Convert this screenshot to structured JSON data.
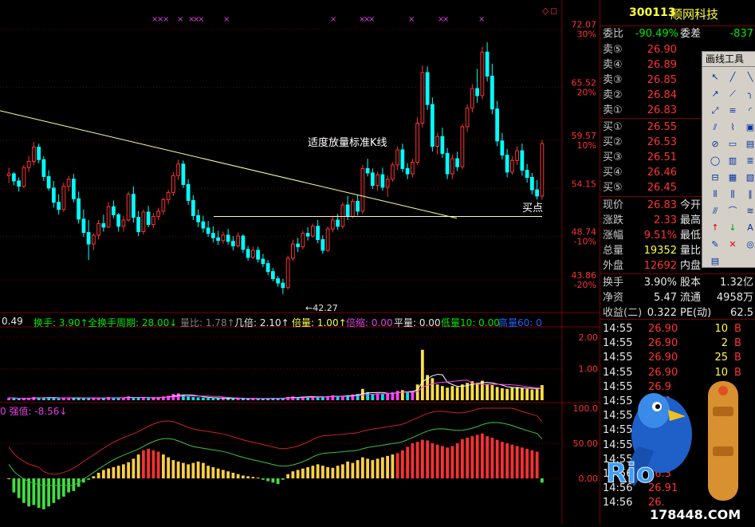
{
  "stock": {
    "code": "300113",
    "name": "顺网科技"
  },
  "price_axis": [
    {
      "price": "72.07",
      "pct": "30%"
    },
    {
      "price": "65.52",
      "pct": "20%"
    },
    {
      "price": "59.57",
      "pct": "10%"
    },
    {
      "price": "54.15",
      "pct": ""
    },
    {
      "price": "48.74",
      "pct": "-10%"
    },
    {
      "price": "43.86",
      "pct": "-20%"
    }
  ],
  "volume_axis": [
    "2.00",
    "1.00"
  ],
  "osc_axis": [
    "100.0",
    "50.00",
    "0.00"
  ],
  "annotations": {
    "breakout": "适度放量标准K线",
    "buy_point": "买点",
    "low_price": "←42.27"
  },
  "indicator_bar": [
    {
      "text": "0.49",
      "color": "#e8e8e8"
    },
    {
      "text": "换手: 3.90↑",
      "color": "#00e600"
    },
    {
      "text": "全换手周期: 28.00↓",
      "color": "#00e600"
    },
    {
      "text": "量比: 1.78↑",
      "color": "#808080"
    },
    {
      "text": "几倍: 2.10↑",
      "color": "#e8e8e8"
    },
    {
      "text": "倍量: 1.00↑",
      "color": "#ffff40"
    },
    {
      "text": "倍缩: 0.00",
      "color": "#e040e0"
    },
    {
      "text": "平量: 0.00",
      "color": "#e8e8e8"
    },
    {
      "text": "低量10: 0.00",
      "color": "#00e600"
    },
    {
      "text": "高量60: 0",
      "color": "#2060ff"
    }
  ],
  "osc_label": "0 强值: -8.56↓",
  "order_book": {
    "ratio_label": "委比",
    "ratio_value": "-90.49%",
    "diff_label": "委差",
    "diff_value": "-837",
    "asks": [
      {
        "label": "卖⑤",
        "price": "26.90"
      },
      {
        "label": "卖④",
        "price": "26.89"
      },
      {
        "label": "卖③",
        "price": "26.85"
      },
      {
        "label": "卖②",
        "price": "26.84"
      },
      {
        "label": "卖①",
        "price": "26.83"
      }
    ],
    "bids": [
      {
        "label": "买①",
        "price": "26.55"
      },
      {
        "label": "买②",
        "price": "26.53"
      },
      {
        "label": "买③",
        "price": "26.51"
      },
      {
        "label": "买④",
        "price": "26.46"
      },
      {
        "label": "买⑤",
        "price": "26.45"
      }
    ]
  },
  "quote_stats": [
    {
      "l1": "现价",
      "v1": "26.83",
      "c1": "red",
      "l2": "今开"
    },
    {
      "l1": "涨跌",
      "v1": "2.33",
      "c1": "red",
      "l2": "最高"
    },
    {
      "l1": "涨幅",
      "v1": "9.51%",
      "c1": "red",
      "l2": "最低"
    },
    {
      "l1": "总量",
      "v1": "19352",
      "c1": "yel",
      "l2": "量比"
    },
    {
      "l1": "外盘",
      "v1": "12692",
      "c1": "red",
      "l2": "内盘"
    }
  ],
  "fund_stats": [
    {
      "l1": "换手",
      "v1": "3.90%",
      "l2": "股本",
      "v2": "1.32亿"
    },
    {
      "l1": "净资",
      "v1": "5.47",
      "l2": "流通",
      "v2": "4958万"
    },
    {
      "l1": "收益(二)",
      "v1": "0.322",
      "l2": "PE(动)",
      "v2": "62.5"
    }
  ],
  "trades": [
    {
      "time": "14:55",
      "price": "26.90",
      "vol": "10",
      "side": "B"
    },
    {
      "time": "14:55",
      "price": "26.90",
      "vol": "2",
      "side": "B"
    },
    {
      "time": "14:55",
      "price": "26.90",
      "vol": "25",
      "side": "B"
    },
    {
      "time": "14:55",
      "price": "26.90",
      "vol": "10",
      "side": "B"
    },
    {
      "time": "14:55",
      "price": "26.9",
      "vol": "",
      "side": ""
    },
    {
      "time": "14:55",
      "price": "26.9",
      "vol": "",
      "side": ""
    },
    {
      "time": "14:55",
      "price": "",
      "vol": "",
      "side": ""
    },
    {
      "time": "14:55",
      "price": "",
      "vol": "",
      "side": ""
    },
    {
      "time": "14:55",
      "price": "",
      "vol": "",
      "side": ""
    },
    {
      "time": "14:55",
      "price": "",
      "vol": "",
      "side": ""
    },
    {
      "time": "14:56",
      "price": "26.3",
      "vol": "",
      "side": ""
    },
    {
      "time": "14:56",
      "price": "26.91",
      "vol": "",
      "side": ""
    },
    {
      "time": "14:56",
      "price": "26.",
      "vol": "",
      "side": ""
    }
  ],
  "drawing_tools": {
    "title": "画线工具"
  },
  "mascot": {
    "brand": "Rio"
  },
  "watermark": "178448.COM",
  "colors": {
    "up": "#ff3232",
    "down": "#00ffff",
    "grid": "#7a0000",
    "trend": "#ffffa0",
    "support": "#fff8c0",
    "ma_red": "#d02020",
    "ma_green": "#40c040"
  },
  "chart_data": {
    "type": "candlestick",
    "title": "",
    "ylim": [
      42.27,
      72.07
    ],
    "candles": [
      [
        55.6,
        56.5,
        54.8,
        55.8
      ],
      [
        55.8,
        56.0,
        54.5,
        55.0
      ],
      [
        55.0,
        55.4,
        53.8,
        54.4
      ],
      [
        54.4,
        56.8,
        54.2,
        56.5
      ],
      [
        56.5,
        57.8,
        56.0,
        57.2
      ],
      [
        57.2,
        59.4,
        56.8,
        58.8
      ],
      [
        58.8,
        59.2,
        57.0,
        57.4
      ],
      [
        57.4,
        57.8,
        55.0,
        55.5
      ],
      [
        55.5,
        56.2,
        53.9,
        54.2
      ],
      [
        54.2,
        55.0,
        52.0,
        52.6
      ],
      [
        52.6,
        53.5,
        51.2,
        51.8
      ],
      [
        51.8,
        54.8,
        51.5,
        54.4
      ],
      [
        54.4,
        55.6,
        53.8,
        55.2
      ],
      [
        55.2,
        55.8,
        52.6,
        53.0
      ],
      [
        53.0,
        53.8,
        50.2,
        50.7
      ],
      [
        50.7,
        51.8,
        48.7,
        49.2
      ],
      [
        49.2,
        50.6,
        46.1,
        47.9
      ],
      [
        47.9,
        49.1,
        47.2,
        48.9
      ],
      [
        48.9,
        50.6,
        48.4,
        50.2
      ],
      [
        50.2,
        51.2,
        49.3,
        49.8
      ],
      [
        49.8,
        52.6,
        49.7,
        52.1
      ],
      [
        52.1,
        52.8,
        50.8,
        51.2
      ],
      [
        51.2,
        51.4,
        49.3,
        49.9
      ],
      [
        49.9,
        51.1,
        49.3,
        50.6
      ],
      [
        50.6,
        53.8,
        50.4,
        53.5
      ],
      [
        53.5,
        54.4,
        50.3,
        50.9
      ],
      [
        50.9,
        51.6,
        48.8,
        49.3
      ],
      [
        49.3,
        51.8,
        49.0,
        51.5
      ],
      [
        51.5,
        52.2,
        49.8,
        50.1
      ],
      [
        50.1,
        51.4,
        49.7,
        51.0
      ],
      [
        51.0,
        52.0,
        50.6,
        51.6
      ],
      [
        51.6,
        53.1,
        51.2,
        52.9
      ],
      [
        52.9,
        54.0,
        52.4,
        53.7
      ],
      [
        53.7,
        56.0,
        53.3,
        55.6
      ],
      [
        55.6,
        57.4,
        55.1,
        56.9
      ],
      [
        56.9,
        57.3,
        54.2,
        54.6
      ],
      [
        54.6,
        55.2,
        52.3,
        52.8
      ],
      [
        52.8,
        53.4,
        50.6,
        51.1
      ],
      [
        51.1,
        51.8,
        49.8,
        50.4
      ],
      [
        50.4,
        51.1,
        49.2,
        49.7
      ],
      [
        49.7,
        50.5,
        48.7,
        49.1
      ],
      [
        49.1,
        49.9,
        48.1,
        48.6
      ],
      [
        48.6,
        49.4,
        47.8,
        48.3
      ],
      [
        48.3,
        49.3,
        47.9,
        48.9
      ],
      [
        48.9,
        49.6,
        47.8,
        48.2
      ],
      [
        48.2,
        48.8,
        47.2,
        47.7
      ],
      [
        47.7,
        49.2,
        47.5,
        48.8
      ],
      [
        48.8,
        49.0,
        46.9,
        47.3
      ],
      [
        47.3,
        47.7,
        46.0,
        46.4
      ],
      [
        46.4,
        47.6,
        46.2,
        47.2
      ],
      [
        47.2,
        47.6,
        45.8,
        46.2
      ],
      [
        46.2,
        46.8,
        45.3,
        45.7
      ],
      [
        45.7,
        46.1,
        44.4,
        44.8
      ],
      [
        44.8,
        45.2,
        43.7,
        44.0
      ],
      [
        44.0,
        44.3,
        43.1,
        43.5
      ],
      [
        43.5,
        44.0,
        42.27,
        43.0
      ],
      [
        43.0,
        46.6,
        42.8,
        46.3
      ],
      [
        46.3,
        48.4,
        46.0,
        47.9
      ],
      [
        47.9,
        48.6,
        47.0,
        47.6
      ],
      [
        47.6,
        49.4,
        47.3,
        49.1
      ],
      [
        49.1,
        49.8,
        48.3,
        48.8
      ],
      [
        48.8,
        50.2,
        48.6,
        49.9
      ],
      [
        49.9,
        50.6,
        48.0,
        48.4
      ],
      [
        48.4,
        48.9,
        46.8,
        47.2
      ],
      [
        47.2,
        49.9,
        47.0,
        49.6
      ],
      [
        49.6,
        51.1,
        49.2,
        50.6
      ],
      [
        50.6,
        51.3,
        49.5,
        49.9
      ],
      [
        49.9,
        52.6,
        49.6,
        52.3
      ],
      [
        52.3,
        53.3,
        50.6,
        51.0
      ],
      [
        51.0,
        53.0,
        50.8,
        52.7
      ],
      [
        52.7,
        53.4,
        51.1,
        51.6
      ],
      [
        51.6,
        56.8,
        51.3,
        56.4
      ],
      [
        56.4,
        57.5,
        55.5,
        55.9
      ],
      [
        55.9,
        56.4,
        54.1,
        54.5
      ],
      [
        54.5,
        56.0,
        53.9,
        55.7
      ],
      [
        55.7,
        56.5,
        53.9,
        54.3
      ],
      [
        54.3,
        55.6,
        53.2,
        55.2
      ],
      [
        55.2,
        57.1,
        54.9,
        56.8
      ],
      [
        56.8,
        58.9,
        56.2,
        58.5
      ],
      [
        58.5,
        59.2,
        56.0,
        56.4
      ],
      [
        56.4,
        57.0,
        55.2,
        55.8
      ],
      [
        55.8,
        57.5,
        55.4,
        57.1
      ],
      [
        57.1,
        62.2,
        56.8,
        61.5
      ],
      [
        61.5,
        68.0,
        61.0,
        67.2
      ],
      [
        67.2,
        67.9,
        63.0,
        63.6
      ],
      [
        63.6,
        64.4,
        58.3,
        58.9
      ],
      [
        58.9,
        60.4,
        58.0,
        60.0
      ],
      [
        60.0,
        61.0,
        57.6,
        58.1
      ],
      [
        58.1,
        58.7,
        55.2,
        55.8
      ],
      [
        55.8,
        58.0,
        55.2,
        57.5
      ],
      [
        57.5,
        58.3,
        56.1,
        56.6
      ],
      [
        56.6,
        61.4,
        56.3,
        61.1
      ],
      [
        61.1,
        63.6,
        60.5,
        63.2
      ],
      [
        63.2,
        65.9,
        62.7,
        65.4
      ],
      [
        65.4,
        67.6,
        63.8,
        64.6
      ],
      [
        64.6,
        70.1,
        64.2,
        69.5
      ],
      [
        69.5,
        70.6,
        66.2,
        66.8
      ],
      [
        66.8,
        68.2,
        62.5,
        63.1
      ],
      [
        63.1,
        64.0,
        58.9,
        59.5
      ],
      [
        59.5,
        60.4,
        57.4,
        57.9
      ],
      [
        57.9,
        58.6,
        55.4,
        56.0
      ],
      [
        56.0,
        57.8,
        55.7,
        57.3
      ],
      [
        57.3,
        58.9,
        56.8,
        58.4
      ],
      [
        58.4,
        59.2,
        55.6,
        56.2
      ],
      [
        56.2,
        56.9,
        54.8,
        55.4
      ],
      [
        55.4,
        55.9,
        53.5,
        54.0
      ],
      [
        54.0,
        55.1,
        52.9,
        53.3
      ],
      [
        53.3,
        59.6,
        52.9,
        59.2
      ]
    ],
    "trend_line": [
      [
        0,
        62.9
      ],
      [
        107,
        50.8
      ]
    ],
    "support_level": 51.0,
    "volume": [
      0.08,
      0.06,
      0.05,
      0.05,
      0.07,
      0.1,
      0.09,
      0.08,
      0.09,
      0.07,
      0.06,
      0.08,
      0.08,
      0.06,
      0.07,
      0.08,
      0.07,
      0.06,
      0.07,
      0.06,
      0.1,
      0.09,
      0.07,
      0.08,
      0.12,
      0.09,
      0.08,
      0.07,
      0.07,
      0.08,
      0.1,
      0.12,
      0.14,
      0.2,
      0.22,
      0.16,
      0.12,
      0.1,
      0.09,
      0.08,
      0.07,
      0.06,
      0.06,
      0.07,
      0.06,
      0.05,
      0.06,
      0.05,
      0.05,
      0.06,
      0.05,
      0.05,
      0.06,
      0.07,
      0.06,
      0.07,
      0.1,
      0.12,
      0.1,
      0.11,
      0.1,
      0.12,
      0.11,
      0.1,
      0.13,
      0.15,
      0.12,
      0.14,
      0.16,
      0.18,
      0.2,
      0.36,
      0.26,
      0.2,
      0.22,
      0.2,
      0.22,
      0.25,
      0.3,
      0.32,
      0.25,
      0.28,
      0.5,
      1.6,
      0.8,
      0.7,
      0.5,
      0.45,
      0.4,
      0.45,
      0.42,
      0.5,
      0.55,
      0.6,
      0.55,
      0.62,
      0.5,
      0.48,
      0.42,
      0.38,
      0.36,
      0.4,
      0.42,
      0.38,
      0.36,
      0.34,
      0.35,
      0.48
    ],
    "oscillator": [
      0,
      -20,
      -28,
      -35,
      -40,
      -38,
      -42,
      -44,
      -40,
      -35,
      -30,
      -26,
      -20,
      -18,
      -12,
      -6,
      -2,
      3,
      8,
      12,
      14,
      16,
      18,
      20,
      23,
      28,
      34,
      40,
      42,
      40,
      38,
      34,
      30,
      26,
      24,
      22,
      20,
      22,
      24,
      22,
      18,
      16,
      14,
      12,
      10,
      8,
      6,
      4,
      3,
      2,
      1,
      -2,
      -4,
      -6,
      -8,
      -2,
      6,
      10,
      12,
      14,
      16,
      18,
      20,
      18,
      16,
      15,
      18,
      20,
      24,
      22,
      26,
      30,
      28,
      26,
      28,
      30,
      32,
      34,
      36,
      40,
      45,
      50,
      52,
      55,
      54,
      50,
      48,
      46,
      44,
      46,
      50,
      56,
      58,
      60,
      62,
      64,
      60,
      58,
      55,
      52,
      50,
      48,
      46,
      44,
      42,
      40,
      38,
      -6
    ]
  }
}
